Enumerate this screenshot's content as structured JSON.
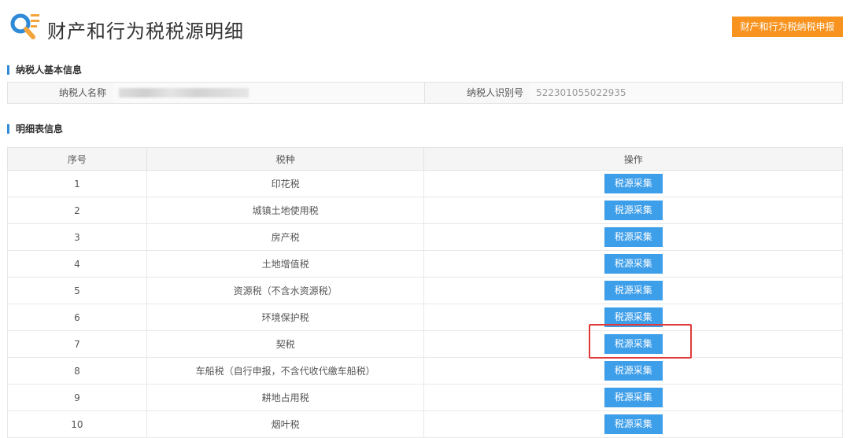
{
  "header": {
    "title": "财产和行为税税源明细",
    "declare_button": "财产和行为税纳税申报",
    "logo_icon": "search-document-icon"
  },
  "basic_info": {
    "section_title": "纳税人基本信息",
    "name_label": "纳税人名称",
    "name_value": "",
    "id_label": "纳税人识别号",
    "id_value": "522301055022935"
  },
  "detail": {
    "section_title": "明细表信息",
    "columns": [
      "序号",
      "税种",
      "操作"
    ],
    "rows": [
      {
        "no": "1",
        "tax": "印花税",
        "action": "税源采集"
      },
      {
        "no": "2",
        "tax": "城镇土地使用税",
        "action": "税源采集"
      },
      {
        "no": "3",
        "tax": "房产税",
        "action": "税源采集"
      },
      {
        "no": "4",
        "tax": "土地增值税",
        "action": "税源采集"
      },
      {
        "no": "5",
        "tax": "资源税（不含水资源税）",
        "action": "税源采集"
      },
      {
        "no": "6",
        "tax": "环境保护税",
        "action": "税源采集"
      },
      {
        "no": "7",
        "tax": "契税",
        "action": "税源采集"
      },
      {
        "no": "8",
        "tax": "车船税（自行申报，不含代收代缴车船税）",
        "action": "税源采集"
      },
      {
        "no": "9",
        "tax": "耕地占用税",
        "action": "税源采集"
      },
      {
        "no": "10",
        "tax": "烟叶税",
        "action": "税源采集"
      }
    ]
  },
  "colors": {
    "accent_orange": "#f7931e",
    "button_blue": "#3d9ee9",
    "highlight_red": "#e03a3a"
  }
}
